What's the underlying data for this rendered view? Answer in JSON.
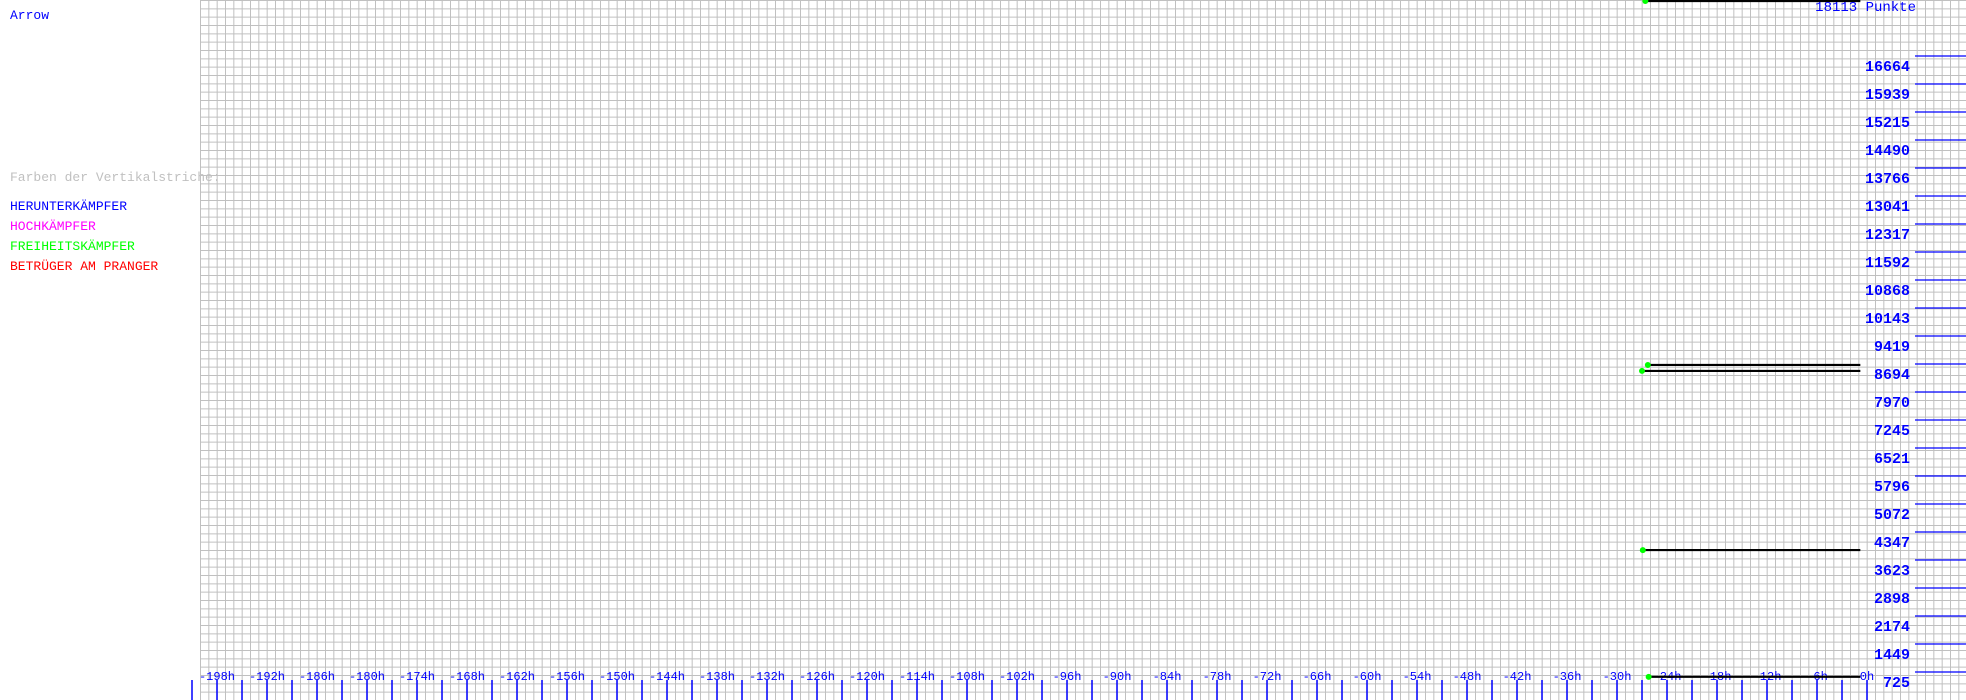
{
  "sidebar": {
    "player_name": "Arrow",
    "legend_title": "Farben der Vertikalstriche:",
    "legend": [
      {
        "label": "HERUNTERKÄMPFER",
        "color": "#0000ff"
      },
      {
        "label": "HOCHKÄMPFER",
        "color": "#ff00ff"
      },
      {
        "label": "FREIHEITSKÄMPFER",
        "color": "#00ff00"
      },
      {
        "label": "BETRÜGER AM PRANGER",
        "color": "#ff0000"
      }
    ]
  },
  "chart_data": {
    "type": "line",
    "title": "18113 Punkte",
    "grid": true,
    "grid_color": "#c0c0c0",
    "axis_color": "#0000ff",
    "line_color": "#000000",
    "marker_color": "#00ff00",
    "xlim": [
      -201,
      0
    ],
    "ylim": [
      725,
      18113
    ],
    "x_tick_labels": [
      "-198h",
      "-192h",
      "-186h",
      "-180h",
      "-174h",
      "-168h",
      "-162h",
      "-156h",
      "-150h",
      "-144h",
      "-138h",
      "-132h",
      "-126h",
      "-120h",
      "-114h",
      "-108h",
      "-102h",
      "-96h",
      "-90h",
      "-84h",
      "-78h",
      "-72h",
      "-66h",
      "-60h",
      "-54h",
      "-48h",
      "-42h",
      "-36h",
      "-30h",
      "-24h",
      "-18h",
      "-12h",
      "-6h",
      "0h"
    ],
    "y_tick_labels": [
      "16664",
      "15939",
      "15215",
      "14490",
      "13766",
      "13041",
      "12317",
      "11592",
      "10868",
      "10143",
      "9419",
      "8694",
      "7970",
      "7245",
      "6521",
      "5796",
      "5072",
      "4347",
      "3623",
      "2898",
      "2174",
      "1449",
      "725"
    ],
    "segments": [
      {
        "x_start": -26.6,
        "x_end": -0.8,
        "y": 18113
      },
      {
        "x_start": -26.3,
        "x_end": -0.8,
        "y": 8670
      },
      {
        "x_start": -27.0,
        "x_end": -0.8,
        "y": 8515
      },
      {
        "x_start": -26.9,
        "x_end": -0.8,
        "y": 3880
      },
      {
        "x_start": -26.2,
        "x_end": -0.8,
        "y": 600
      }
    ]
  }
}
